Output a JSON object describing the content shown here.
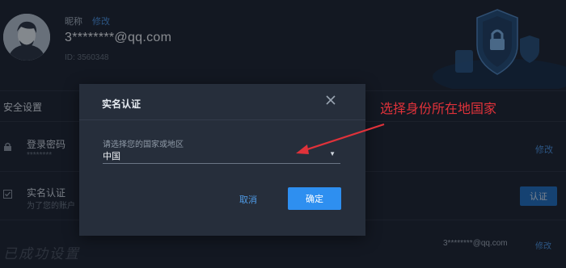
{
  "profile": {
    "nickname_label": "昵称",
    "edit_label": "修改",
    "email": "3********@qq.com",
    "id_text": "ID: 3560348"
  },
  "security": {
    "title": "安全设置",
    "rows": [
      {
        "label": "登录密码",
        "sub": "********",
        "action": "修改"
      },
      {
        "label": "实名认证",
        "sub": "为了您的账户",
        "action": "认证"
      }
    ],
    "bottom_email": "3********@qq.com",
    "bottom_edit": "修改",
    "bottom_text": "已成功设置"
  },
  "dialog": {
    "title": "实名认证",
    "field_label": "请选择您的国家或地区",
    "selected_country": "中国",
    "cancel_label": "取消",
    "confirm_label": "确定"
  },
  "annotation": {
    "text": "选择身份所在地国家",
    "color": "#e0323a"
  },
  "colors": {
    "background": "#1d2431",
    "accent": "#2e8ff0",
    "link": "#4a93e0"
  }
}
